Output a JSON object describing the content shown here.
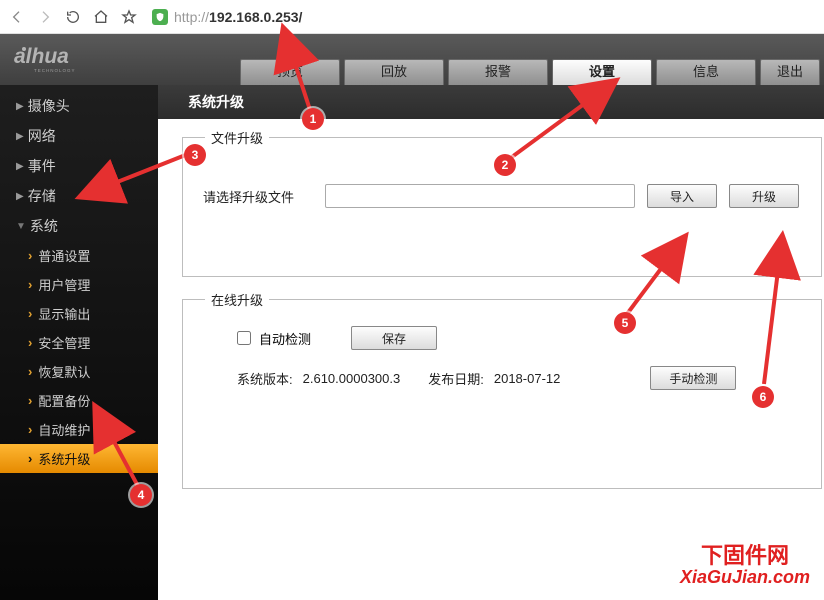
{
  "browser": {
    "protocol": "http://",
    "host": "192.168.0.253/"
  },
  "topnav": {
    "items": [
      "预览",
      "回放",
      "报警",
      "设置",
      "信息",
      "退出"
    ],
    "active_index": 3
  },
  "page": {
    "title": "系统升级"
  },
  "sidebar": {
    "groups": [
      {
        "label": "摄像头",
        "open": false
      },
      {
        "label": "网络",
        "open": false
      },
      {
        "label": "事件",
        "open": false
      },
      {
        "label": "存储",
        "open": false
      },
      {
        "label": "系统",
        "open": true,
        "children": [
          "普通设置",
          "用户管理",
          "显示输出",
          "安全管理",
          "恢复默认",
          "配置备份",
          "自动维护",
          "系统升级"
        ],
        "active_child_index": 7
      }
    ]
  },
  "file_upgrade": {
    "panel_title": "文件升级",
    "select_label": "请选择升级文件",
    "import_btn": "导入",
    "upgrade_btn": "升级",
    "file_value": ""
  },
  "online_upgrade": {
    "panel_title": "在线升级",
    "auto_detect_label": "自动检测",
    "auto_detect_checked": false,
    "save_btn": "保存",
    "version_label": "系统版本:",
    "version_value": "2.610.0000300.3",
    "release_label": "发布日期:",
    "release_value": "2018-07-12",
    "manual_btn": "手动检测"
  },
  "annotations": {
    "badges": [
      "1",
      "2",
      "3",
      "4",
      "5",
      "6"
    ]
  },
  "watermark": {
    "cn": "下固件网",
    "en": "XiaGuJian.com"
  }
}
